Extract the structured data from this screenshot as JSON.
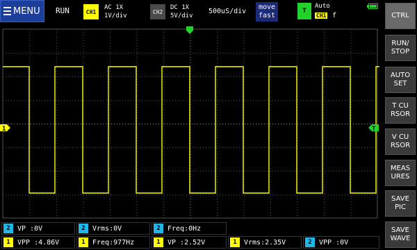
{
  "topbar": {
    "menu_label": "MENU",
    "run_status": "RUN",
    "ch1": {
      "badge": "CH1",
      "coupling": "AC  1X",
      "scale": "1V/div"
    },
    "ch2": {
      "badge": "CH2",
      "coupling": "DC  1X",
      "scale": "5V/div"
    },
    "timebase": "500uS/div",
    "move_label_1": "move",
    "move_label_2": "fast",
    "trigger": {
      "badge": "T",
      "mode": "Auto",
      "source": "CH1",
      "edge": "f"
    },
    "battery_color": "#22d12c"
  },
  "grid": {
    "ch1_marker": "1",
    "trigger_marker": "T",
    "ch1_color": "#ffff00",
    "trigger_color": "#22d12c"
  },
  "sidebar": {
    "items": [
      {
        "id": "ctrl",
        "label": "CTRL"
      },
      {
        "id": "run-stop",
        "label": "RUN/\nSTOP"
      },
      {
        "id": "auto-set",
        "label": "AUTO\nSET"
      },
      {
        "id": "t-cursor",
        "label": "T CU\nRSOR"
      },
      {
        "id": "v-cursor",
        "label": "V CU\nRSOR"
      },
      {
        "id": "measures",
        "label": "MEAS\nURES"
      },
      {
        "id": "save-pic",
        "label": "SAVE\nPIC"
      },
      {
        "id": "save-wave",
        "label": "SAVE\nWAVE"
      }
    ]
  },
  "measurements": {
    "row1": [
      {
        "ch": "2",
        "text": "VP  :0V"
      },
      {
        "ch": "2",
        "text": "Vrms:0V"
      },
      {
        "ch": "2",
        "text": "Freq:0Hz"
      }
    ],
    "row2": [
      {
        "ch": "1",
        "text": "VPP :4.86V"
      },
      {
        "ch": "1",
        "text": "Freq:977Hz"
      },
      {
        "ch": "1",
        "text": "VP  :2.52V"
      },
      {
        "ch": "1",
        "text": "Vrms:2.35V"
      },
      {
        "ch": "2",
        "text": "VPP :0V"
      }
    ]
  },
  "waveform": {
    "channel": "CH1",
    "signal": "square",
    "frequency_hz": 977
  }
}
